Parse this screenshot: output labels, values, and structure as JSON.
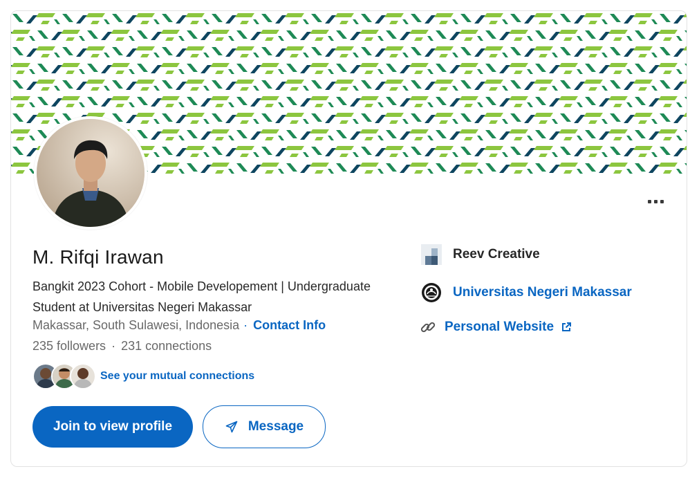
{
  "profile": {
    "name": "M. Rifqi Irawan",
    "headline": "Bangkit 2023 Cohort - Mobile Developement | Undergraduate Student at Universitas Negeri Makassar",
    "location": "Makassar, South Sulawesi, Indonesia",
    "dot": "·",
    "contact_info": "Contact Info",
    "followers": "235 followers",
    "connections": "231 connections",
    "mutual_link": "See your mutual connections"
  },
  "actions": {
    "join": "Join to view profile",
    "message": "Message",
    "more": "more-icon"
  },
  "sidebar": {
    "company": "Reev Creative",
    "school": "Universitas Negeri Makassar",
    "website": "Personal Website"
  },
  "colors": {
    "accent": "#0a66c2",
    "banner_lime": "#8cc63f",
    "banner_green": "#1e8a56",
    "banner_navy": "#0e4660"
  },
  "icons": {
    "company_logo": "company-logo-icon",
    "school_logo": "university-seal-icon",
    "link": "link-chain-icon",
    "external": "external-link-icon",
    "send": "paper-plane-icon"
  }
}
